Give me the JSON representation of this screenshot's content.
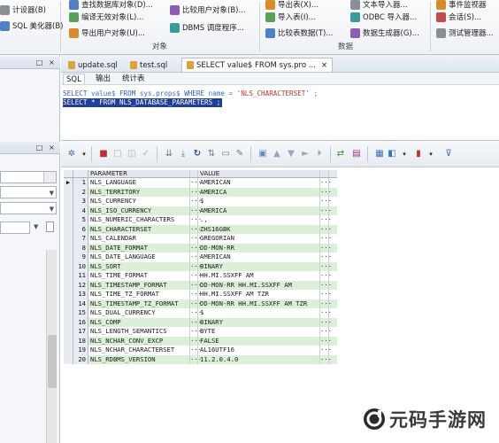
{
  "ribbon": {
    "left_col": [
      {
        "label": "计设器(B)",
        "icon": "table-design-icon"
      },
      {
        "label": "SQL 美化器(B)",
        "icon": "sql-beautifier-icon"
      }
    ],
    "col2": [
      {
        "label": "查找数据库对象(D)...",
        "icon": "find-object-icon"
      },
      {
        "label": "编译无效对象(L)...",
        "icon": "compile-icon"
      },
      {
        "label": "导出用户对象(U)...",
        "icon": "export-user-icon"
      }
    ],
    "col3": [
      {
        "label": "比较用户对象(B)...",
        "icon": "compare-user-icon"
      },
      {
        "label": "DBMS 调度程序...",
        "icon": "dbms-scheduler-icon"
      }
    ],
    "col4": [
      {
        "label": "导出表(X)...",
        "icon": "export-table-icon"
      },
      {
        "label": "导入表(I)...",
        "icon": "import-table-icon"
      },
      {
        "label": "比较表数据(T)...",
        "icon": "compare-data-icon"
      }
    ],
    "col5": [
      {
        "label": "文本导入器...",
        "icon": "text-import-icon"
      },
      {
        "label": "ODBC 导入器...",
        "icon": "odbc-import-icon"
      },
      {
        "label": "数据生成器(G)...",
        "icon": "data-generator-icon"
      }
    ],
    "col6": [
      {
        "label": "事件监视器",
        "icon": "event-monitor-icon"
      },
      {
        "label": "会话(S)...",
        "icon": "session-icon"
      },
      {
        "label": "测试管理器...",
        "icon": "test-manager-icon"
      }
    ],
    "groups": {
      "objects": "对象",
      "data": "数据"
    }
  },
  "editor": {
    "tabs": [
      "update.sql",
      "test.sql",
      "SELECT value$ FROM sys.pro ..."
    ],
    "close_glyph": "×",
    "subtabs": [
      "SQL",
      "输出",
      "统计表"
    ],
    "code_line_1": {
      "kw1": "SELECT",
      "t1": " value$ ",
      "kw2": "FROM",
      "t2": " sys.props$ ",
      "kw3": "WHERE",
      "t3": " name = ",
      "str": "'NLS_CHARACTERSET'",
      "t4": " ;"
    },
    "code_line_2": "SELECT * FROM NLS_DATABASE_PARAMETERS ;"
  },
  "grid": {
    "headers": {
      "param": "PARAMETER",
      "value": "VALUE"
    },
    "current_row_marker": "▶",
    "dots": "···",
    "rows": [
      {
        "n": "1",
        "p": "NLS_LANGUAGE",
        "v": "AMERICAN"
      },
      {
        "n": "2",
        "p": "NLS_TERRITORY",
        "v": "AMERICA"
      },
      {
        "n": "3",
        "p": "NLS_CURRENCY",
        "v": "$"
      },
      {
        "n": "4",
        "p": "NLS_ISO_CURRENCY",
        "v": "AMERICA"
      },
      {
        "n": "5",
        "p": "NLS_NUMERIC_CHARACTERS",
        "v": ".,"
      },
      {
        "n": "6",
        "p": "NLS_CHARACTERSET",
        "v": "ZHS16GBK"
      },
      {
        "n": "7",
        "p": "NLS_CALENDAR",
        "v": "GREGORIAN"
      },
      {
        "n": "8",
        "p": "NLS_DATE_FORMAT",
        "v": "DD-MON-RR"
      },
      {
        "n": "9",
        "p": "NLS_DATE_LANGUAGE",
        "v": "AMERICAN"
      },
      {
        "n": "10",
        "p": "NLS_SORT",
        "v": "BINARY"
      },
      {
        "n": "11",
        "p": "NLS_TIME_FORMAT",
        "v": "HH.MI.SSXFF AM"
      },
      {
        "n": "12",
        "p": "NLS_TIMESTAMP_FORMAT",
        "v": "DD-MON-RR HH.MI.SSXFF AM"
      },
      {
        "n": "13",
        "p": "NLS_TIME_TZ_FORMAT",
        "v": "HH.MI.SSXFF AM TZR"
      },
      {
        "n": "14",
        "p": "NLS_TIMESTAMP_TZ_FORMAT",
        "v": "DD-MON-RR HH.MI.SSXFF AM TZR"
      },
      {
        "n": "15",
        "p": "NLS_DUAL_CURRENCY",
        "v": "$"
      },
      {
        "n": "16",
        "p": "NLS_COMP",
        "v": "BINARY"
      },
      {
        "n": "17",
        "p": "NLS_LENGTH_SEMANTICS",
        "v": "BYTE"
      },
      {
        "n": "18",
        "p": "NLS_NCHAR_CONV_EXCP",
        "v": "FALSE"
      },
      {
        "n": "19",
        "p": "NLS_NCHAR_CHARACTERSET",
        "v": "AL16UTF16"
      },
      {
        "n": "20",
        "p": "NLS_RDBMS_VERSION",
        "v": "11.2.0.4.0"
      }
    ]
  },
  "left_panel": {
    "pin": "□",
    "close": "×",
    "drop": "▼"
  },
  "watermark": "元码手游网",
  "colors": {
    "row_alt": "#dcefd7",
    "selection": "#1f3f9a",
    "keyword": "#2d5bd3",
    "string": "#c0392b"
  }
}
